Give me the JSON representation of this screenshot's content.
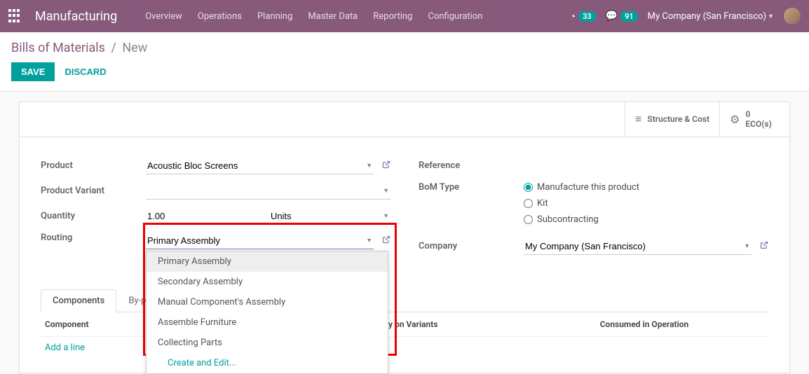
{
  "navbar": {
    "brand": "Manufacturing",
    "menu": [
      "Overview",
      "Operations",
      "Planning",
      "Master Data",
      "Reporting",
      "Configuration"
    ],
    "activities_count": "33",
    "messages_count": "91",
    "company": "My Company (San Francisco)"
  },
  "breadcrumb": {
    "root": "Bills of Materials",
    "current": "New"
  },
  "actions": {
    "save": "SAVE",
    "discard": "DISCARD"
  },
  "stat_buttons": {
    "structure": "Structure & Cost",
    "ecos_count": "0",
    "ecos_label": "ECO(s)"
  },
  "left_fields": {
    "product_label": "Product",
    "product_value": "Acoustic Bloc Screens",
    "variant_label": "Product Variant",
    "variant_value": "",
    "qty_label": "Quantity",
    "qty_value": "1.00",
    "uom_value": "Units",
    "routing_label": "Routing",
    "routing_value": "Primary Assembly"
  },
  "routing_options": [
    "Primary Assembly",
    "Secondary Assembly",
    "Manual Component's Assembly",
    "Assemble Furniture",
    "Collecting Parts"
  ],
  "routing_create": "Create and Edit...",
  "right_fields": {
    "reference_label": "Reference",
    "bom_type_label": "BoM Type",
    "bom_type_options": [
      "Manufacture this product",
      "Kit",
      "Subcontracting"
    ],
    "company_label": "Company",
    "company_value": "My Company (San Francisco)"
  },
  "tabs": {
    "components": "Components",
    "byproducts": "By-products"
  },
  "table": {
    "th_component": "Component",
    "th_apply": "Apply on Variants",
    "th_consumed": "Consumed in Operation",
    "add_line": "Add a line"
  }
}
